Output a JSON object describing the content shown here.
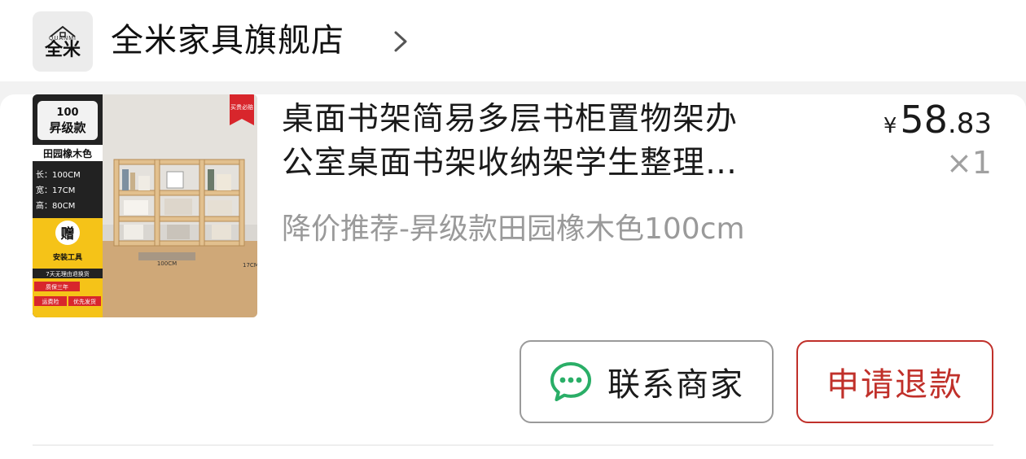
{
  "store": {
    "logo_text_en": "QUANMI",
    "logo_text_cn": "全米",
    "name": "全米家具旗舰店",
    "chevron_icon": "chevron-right-icon"
  },
  "product": {
    "title_line1": "桌面书架简易多层书柜置物架办",
    "title_line2": "公室桌面书架收纳架学生整理…",
    "sku": "降价推荐-昇级款田园橡木色100cm",
    "price": {
      "currency": "¥",
      "integer": "58",
      "decimal": ".83"
    },
    "quantity": "×1",
    "image": {
      "badge_top": "100",
      "badge_title": "昇级款",
      "color_label": "田园橡木色",
      "dim_length": "长：100CM",
      "dim_width": "宽：17CM",
      "dim_height": "高：80CM",
      "gift": "赠",
      "gift_item": "安装工具",
      "promo1": "7天无理由退换货",
      "promo2": "质保三年",
      "promo3": "运费险",
      "promo4": "优先发货",
      "corner_tag": "买贵必赔",
      "measure_100": "100CM",
      "measure_17": "17CM"
    }
  },
  "actions": {
    "contact_label": "联系商家",
    "refund_label": "申请退款"
  },
  "colors": {
    "refund_accent": "#c0302a",
    "wechat_green": "#2aae67",
    "price_text": "#1a1a1a",
    "muted_text": "#9a9a9a"
  }
}
